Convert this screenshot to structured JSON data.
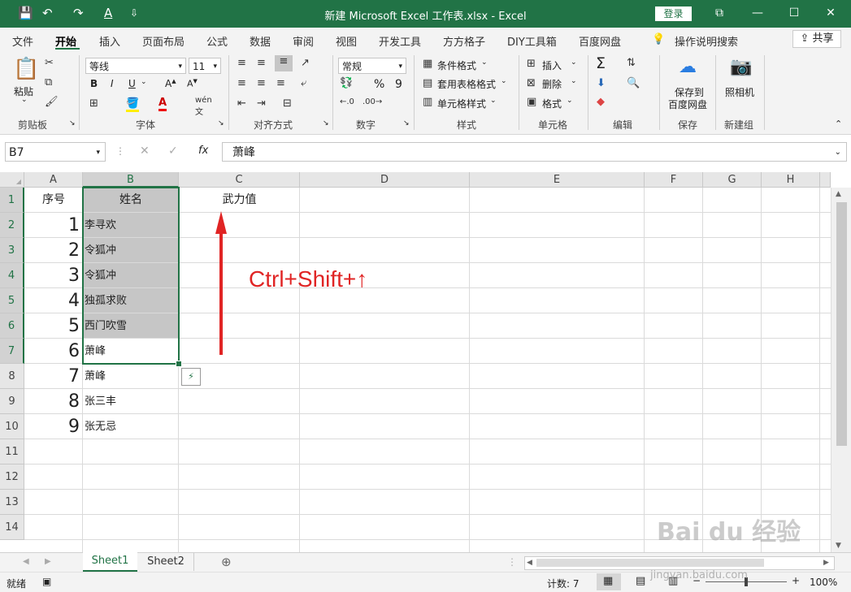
{
  "quick_access": {
    "save": "💾",
    "undo": "↶",
    "redo": "↷",
    "font_color": "A",
    "customize": "⇩"
  },
  "window": {
    "title": "新建 Microsoft Excel 工作表.xlsx  -  Excel",
    "login": "登录",
    "ribbon_display": "⧉",
    "minimize": "—",
    "maximize": "☐",
    "close": "✕"
  },
  "menu": {
    "tabs": [
      "文件",
      "开始",
      "插入",
      "页面布局",
      "公式",
      "数据",
      "审阅",
      "视图",
      "开发工具",
      "方方格子",
      "DIY工具箱",
      "百度网盘"
    ],
    "tell_me": "操作说明搜索",
    "share": "共享"
  },
  "ribbon": {
    "clipboard": {
      "paste": "粘贴",
      "label": "剪贴板"
    },
    "font": {
      "name": "等线",
      "size": "11",
      "bold": "B",
      "italic": "I",
      "underline": "U",
      "label": "字体"
    },
    "alignment": {
      "label": "对齐方式"
    },
    "number": {
      "format": "常规",
      "percent": "%",
      "comma": "9",
      "label": "数字"
    },
    "styles": {
      "conditional": "条件格式",
      "table": "套用表格格式",
      "cell": "单元格样式",
      "label": "样式"
    },
    "cells": {
      "insert": "插入",
      "delete": "删除",
      "format": "格式",
      "label": "单元格"
    },
    "editing": {
      "sum": "Σ",
      "label": "编辑"
    },
    "save": {
      "button": "保存到\n百度网盘",
      "line1": "保存到",
      "line2": "百度网盘",
      "label": "保存"
    },
    "new_group": {
      "camera": "照相机",
      "label": "新建组"
    }
  },
  "formula_bar": {
    "name_box": "B7",
    "fx": "fx",
    "content": "萧峰"
  },
  "columns": [
    "A",
    "B",
    "C",
    "D",
    "E",
    "F",
    "G",
    "H"
  ],
  "rows": [
    "1",
    "2",
    "3",
    "4",
    "5",
    "6",
    "7",
    "8",
    "9",
    "10",
    "11",
    "12",
    "13",
    "14"
  ],
  "cells": {
    "A1": "序号",
    "B1": "姓名",
    "C1": "武力值",
    "A2": "1",
    "B2": "李寻欢",
    "A3": "2",
    "B3": "令狐冲",
    "A4": "3",
    "B4": "令狐冲",
    "A5": "4",
    "B5": "独孤求败",
    "A6": "5",
    "B6": "西门吹雪",
    "A7": "6",
    "B7": "萧峰",
    "A8": "7",
    "B8": "萧峰",
    "A9": "8",
    "B9": "张三丰",
    "A10": "9",
    "B10": "张无忌"
  },
  "annotation": {
    "text": "Ctrl+Shift+↑",
    "color": "#e02424"
  },
  "sheets": [
    "Sheet1",
    "Sheet2"
  ],
  "status": {
    "ready": "就绪",
    "count": "计数: 7",
    "zoom": "100%"
  },
  "watermark": {
    "line1": "Bai du 经验",
    "line2": "jingyan.baidu.com"
  },
  "colors": {
    "accent": "#217346",
    "selection": "#c6c6c6"
  }
}
